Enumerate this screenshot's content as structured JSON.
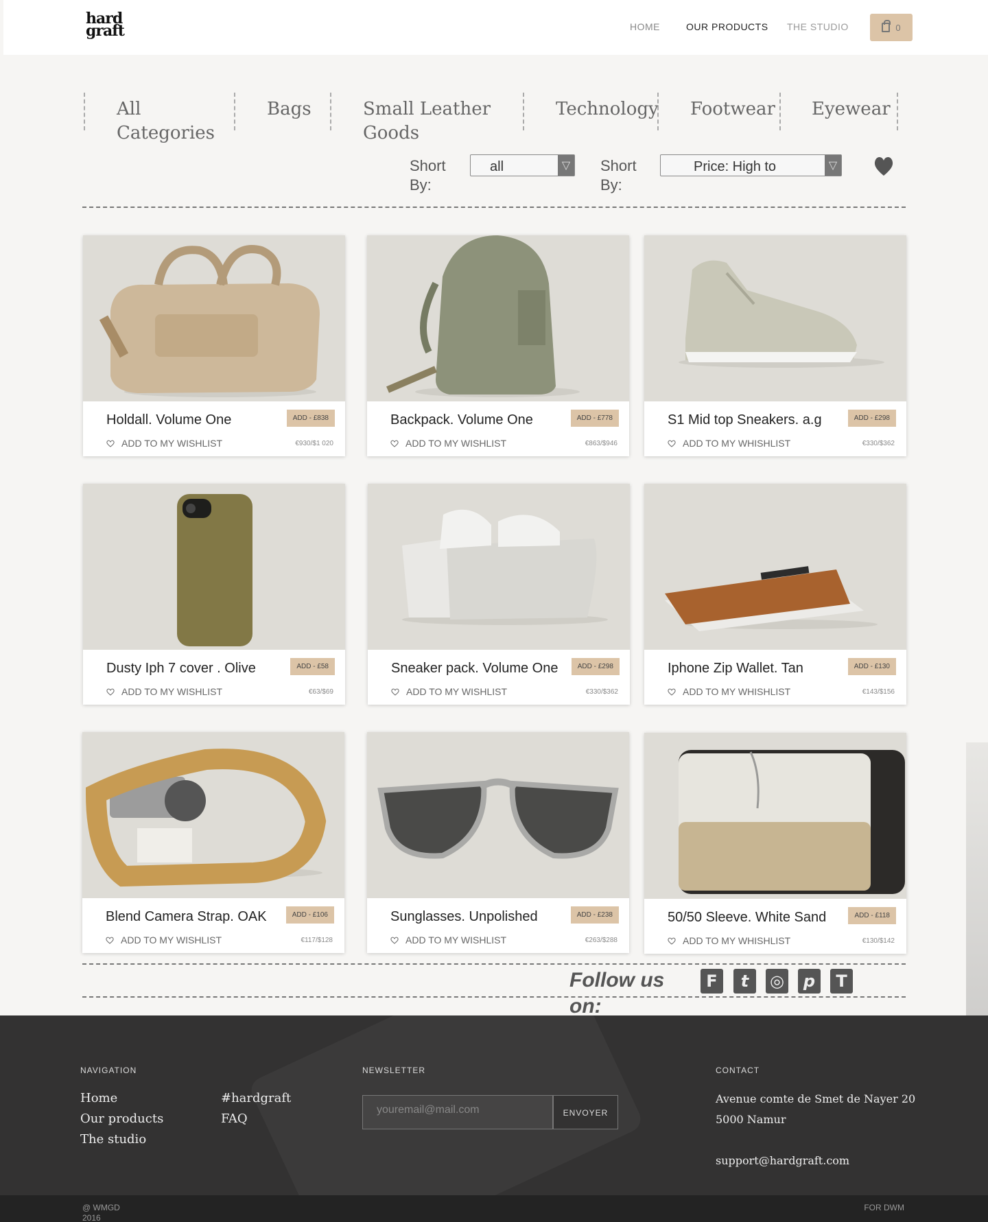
{
  "header": {
    "logo": "hard graft",
    "nav": [
      "HOME",
      "OUR PRODUCTS",
      "THE STUDIO"
    ],
    "cart_count": "0"
  },
  "categories": [
    "All Categories",
    "Bags",
    "Small Leather Goods",
    "Technology",
    "Footwear",
    "Eyewear"
  ],
  "sort": {
    "label1": "Short By:",
    "value1": "all",
    "label2": "Short By:",
    "value2": "Price: High to"
  },
  "products": [
    {
      "name": "Holdall. Volume One",
      "wish": "ADD TO MY WISHLIST",
      "add": "ADD - £838",
      "price": "€930/$1 020"
    },
    {
      "name": "Backpack. Volume One",
      "wish": "ADD TO MY WISHLIST",
      "add": "ADD - £778",
      "price": "€863/$946"
    },
    {
      "name": "S1 Mid top Sneakers. a.g",
      "wish": "ADD TO MY WHISHLIST",
      "add": "ADD - £298",
      "price": "€330/$362"
    },
    {
      "name": "Dusty Iph 7 cover . Olive",
      "wish": "ADD TO MY WISHLIST",
      "add": "ADD - £58",
      "price": "€63/$69"
    },
    {
      "name": "Sneaker pack. Volume One",
      "wish": "ADD TO MY WISHLIST",
      "add": "ADD - £298",
      "price": "€330/$362"
    },
    {
      "name": "Iphone Zip Wallet. Tan",
      "wish": "ADD TO MY WHISHLIST",
      "add": "ADD - £130",
      "price": "€143/$156"
    },
    {
      "name": "Blend Camera Strap. OAK",
      "wish": "ADD TO MY WISHLIST",
      "add": "ADD - £106",
      "price": "€117/$128"
    },
    {
      "name": "Sunglasses. Unpolished",
      "wish": "ADD TO MY WISHLIST",
      "add": "ADD - £238",
      "price": "€263/$288"
    },
    {
      "name": "50/50 Sleeve. White Sand",
      "wish": "ADD TO MY WHISHLIST",
      "add": "ADD - £118",
      "price": "€130/$142"
    }
  ],
  "follow": {
    "label": "Follow us on:",
    "icons": [
      "F",
      "t",
      "◎",
      "p",
      "T"
    ]
  },
  "footer": {
    "nav_head": "NAVIGATION",
    "nav_links": [
      "Home",
      "Our products",
      "The studio"
    ],
    "nav_links2": [
      "#hardgraft",
      "FAQ"
    ],
    "news_head": "NEWSLETTER",
    "email_placeholder": "youremail@mail.com",
    "send": "ENVOYER",
    "contact_head": "CONTACT",
    "address1": "Avenue comte de Smet de Nayer 20",
    "address2": "5000 Namur",
    "email": "support@hardgraft.com"
  },
  "bottom": {
    "left": "@ WMGD 2016",
    "right": "FOR DWM"
  }
}
